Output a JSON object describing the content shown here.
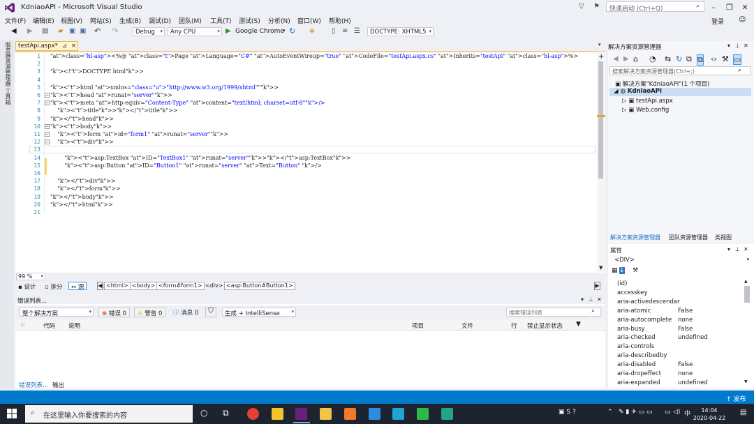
{
  "window": {
    "title": "KdniaoAPI - Microsoft Visual Studio",
    "quick_launch_placeholder": "快速启动 (Ctrl+Q)",
    "login": "登录"
  },
  "menu": [
    "文件(F)",
    "编辑(E)",
    "视图(V)",
    "网站(S)",
    "生成(B)",
    "调试(D)",
    "团队(M)",
    "工具(T)",
    "测试(S)",
    "分析(N)",
    "窗口(W)",
    "帮助(H)"
  ],
  "toolbar": {
    "config": "Debug",
    "platform": "Any CPU",
    "run_target": "Google Chrome",
    "doctype": "DOCTYPE: XHTML5"
  },
  "left_side_tab": "服务器资源管理器 工具箱",
  "doc_tab": {
    "name": "testApi.aspx*",
    "pin": "⊿",
    "close": "×"
  },
  "editor": {
    "lines": [
      {
        "n": "1",
        "code": "<%@ Page Language=\"C#\" AutoEventWireup=\"true\" CodeFile=\"testApi.aspx.cs\" Inherits=\"testApi\" %>"
      },
      {
        "n": "2",
        "code": ""
      },
      {
        "n": "3",
        "code": "<!DOCTYPE html>"
      },
      {
        "n": "4",
        "code": ""
      },
      {
        "n": "5",
        "code": "<html xmlns=\"http://www.w3.org/1999/xhtml\">"
      },
      {
        "n": "6",
        "code": "<head runat=\"server\">"
      },
      {
        "n": "7",
        "code": "<meta http-equiv=\"Content-Type\" content=\"text/html; charset=utf-8\"/>"
      },
      {
        "n": "8",
        "code": "    <title></title>"
      },
      {
        "n": "9",
        "code": "</head>"
      },
      {
        "n": "10",
        "code": "<body>"
      },
      {
        "n": "11",
        "code": "    <form id=\"form1\" runat=\"server\">"
      },
      {
        "n": "12",
        "code": "    <div>"
      },
      {
        "n": "13",
        "code": ""
      },
      {
        "n": "14",
        "code": "        <asp:TextBox ID=\"TextBox1\" runat=\"server\"></asp:TextBox>"
      },
      {
        "n": "15",
        "code": "        <asp:Button ID=\"Button1\" runat=\"server\" Text=\"Button\" />"
      },
      {
        "n": "16",
        "code": ""
      },
      {
        "n": "17",
        "code": "    </div>"
      },
      {
        "n": "18",
        "code": "    </form>"
      },
      {
        "n": "19",
        "code": "</body>"
      },
      {
        "n": "20",
        "code": "</html>"
      },
      {
        "n": "21",
        "code": ""
      }
    ],
    "zoom": "99 %"
  },
  "view_tabs": {
    "design": "设计",
    "split": "拆分",
    "source": "源"
  },
  "breadcrumbs": [
    "<html>",
    "<body>",
    "<form#form1>",
    "<div>",
    "<asp:Button#Button1>"
  ],
  "error_list": {
    "title": "错误列表...",
    "scope": "整个解决方案",
    "errors": "错误 0",
    "warnings": "警告 0",
    "messages": "消息 0",
    "build_filter": "生成 + IntelliSense",
    "search_placeholder": "搜索错误列表",
    "columns": [
      "代码",
      "说明",
      "项目",
      "文件",
      "行",
      "禁止显示状态"
    ]
  },
  "bottom_tabs": [
    "错误列表...",
    "输出"
  ],
  "solution_explorer": {
    "title": "解决方案资源管理器",
    "search_placeholder": "搜索解决方案资源管理器(Ctrl+;)",
    "solution": "解决方案\"KdniaoAPI\"(1 个项目)",
    "project": "KdniaoAPI",
    "items": [
      "testApi.aspx",
      "Web.config"
    ],
    "tabs": [
      "解决方案资源管理器",
      "团队资源管理器",
      "类视图"
    ]
  },
  "properties": {
    "title": "属性",
    "object": "<DIV>",
    "rows": [
      {
        "name": "(id)",
        "value": ""
      },
      {
        "name": "accesskey",
        "value": ""
      },
      {
        "name": "aria-activedescendar",
        "value": ""
      },
      {
        "name": "aria-atomic",
        "value": "False"
      },
      {
        "name": "aria-autocomplete",
        "value": "none"
      },
      {
        "name": "aria-busy",
        "value": "False"
      },
      {
        "name": "aria-checked",
        "value": "undefined"
      },
      {
        "name": "aria-controls",
        "value": ""
      },
      {
        "name": "aria-describedby",
        "value": ""
      },
      {
        "name": "aria-disabled",
        "value": "False"
      },
      {
        "name": "aria-dropeffect",
        "value": "none"
      },
      {
        "name": "aria-expanded",
        "value": "undefined"
      }
    ]
  },
  "status_bar": {
    "publish": "↑ 发布"
  },
  "taskbar": {
    "search_placeholder": "在这里输入你要搜索的内容",
    "time": "14:04",
    "date": "2020-04-22",
    "ime": "中"
  },
  "colors": {
    "accent": "#007acc",
    "vs_purple": "#68217a",
    "keyword": "#0000ff",
    "tag": "#800000",
    "attr": "#ff0000"
  }
}
